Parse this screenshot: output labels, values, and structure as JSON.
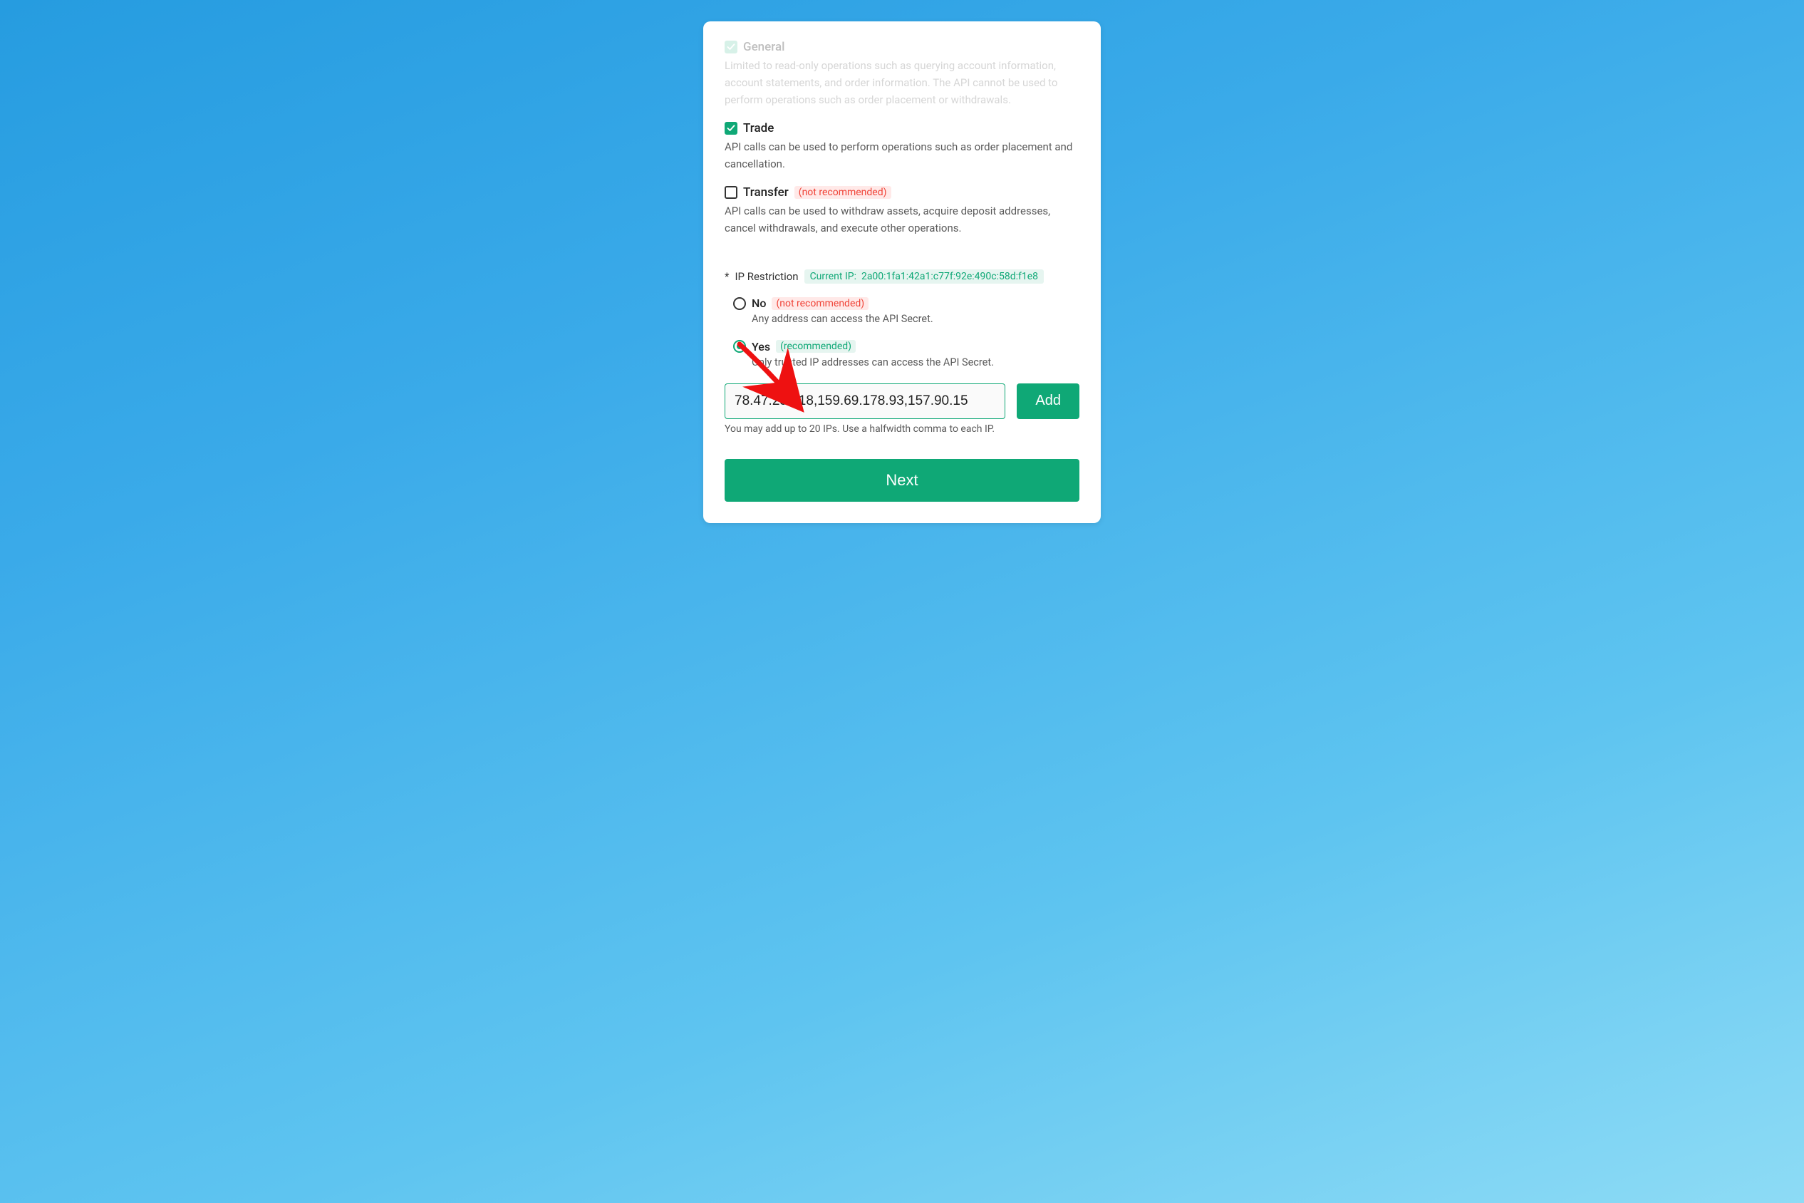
{
  "permissions": {
    "general": {
      "title": "General",
      "desc": "Limited to read-only operations such as querying account information, account statements, and order information. The API cannot be used to perform operations such as order placement or withdrawals."
    },
    "trade": {
      "title": "Trade",
      "desc": "API calls can be used to perform operations such as order placement and cancellation."
    },
    "transfer": {
      "title": "Transfer",
      "badge": "(not recommended)",
      "desc": "API calls can be used to withdraw assets, acquire deposit addresses, cancel withdrawals, and execute other operations."
    }
  },
  "ip_restriction": {
    "label_prefix": "*",
    "label": "IP Restriction",
    "current_ip_label": "Current IP:",
    "current_ip": "2a00:1fa1:42a1:c77f:92e:490c:58d:f1e8",
    "no": {
      "label": "No",
      "badge": "(not recommended)",
      "desc": "Any address can access the API Secret."
    },
    "yes": {
      "label": "Yes",
      "badge": "(recommended)",
      "desc": "Only trusted IP addresses can access the API Secret."
    },
    "ip_value": "78.47.252.18,159.69.178.93,157.90.15",
    "add_label": "Add",
    "hint": "You may add up to 20 IPs. Use a halfwidth comma to each IP."
  },
  "next_label": "Next"
}
